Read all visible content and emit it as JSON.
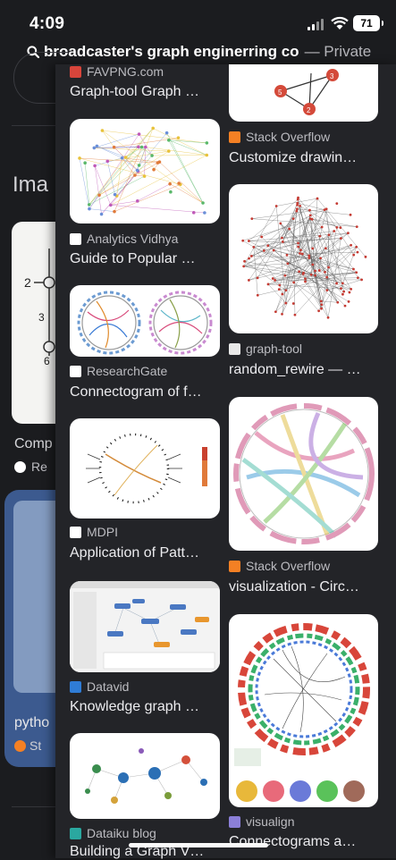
{
  "status": {
    "time": "4:09",
    "battery": "71"
  },
  "search": {
    "query": "broadcaster's graph enginerring co",
    "mode": "— Private"
  },
  "background": {
    "heading": "Ima",
    "card1_title": "Comp",
    "card1_source": "Re",
    "card2_title": "pytho",
    "card2_source": "St"
  },
  "results": [
    {
      "source": "FAVPNG.com",
      "title": "Graph-tool Graph …",
      "favicon": "favpng-icon",
      "color": "#d8453b"
    },
    {
      "source": "Stack Overflow",
      "title": "Customize drawin…",
      "favicon": "stackoverflow-icon",
      "color": "#f48024"
    },
    {
      "source": "Analytics Vidhya",
      "title": "Guide to Popular …",
      "favicon": "analytics-vidhya-icon",
      "color": "#3b73c8"
    },
    {
      "source": "graph-tool",
      "title": "random_rewire — …",
      "favicon": "graph-tool-icon",
      "color": "#e8e8e8"
    },
    {
      "source": "ResearchGate",
      "title": "Connectogram of f…",
      "favicon": "researchgate-icon",
      "color": "#ffffff"
    },
    {
      "source": "MDPI",
      "title": "Application of Patt…",
      "favicon": "mdpi-icon",
      "color": "#e8e8e8"
    },
    {
      "source": "Stack Overflow",
      "title": "visualization - Circ…",
      "favicon": "stackoverflow-icon",
      "color": "#f48024"
    },
    {
      "source": "Datavid",
      "title": "Knowledge graph …",
      "favicon": "datavid-icon",
      "color": "#2f7cd6"
    },
    {
      "source": "visualign",
      "title": "Connectograms a…",
      "favicon": "visualign-icon",
      "color": "#8b7fd8"
    },
    {
      "source": "Dataiku blog",
      "title": "Building a Graph V…",
      "favicon": "dataiku-icon",
      "color": "#2aa8a0"
    }
  ]
}
